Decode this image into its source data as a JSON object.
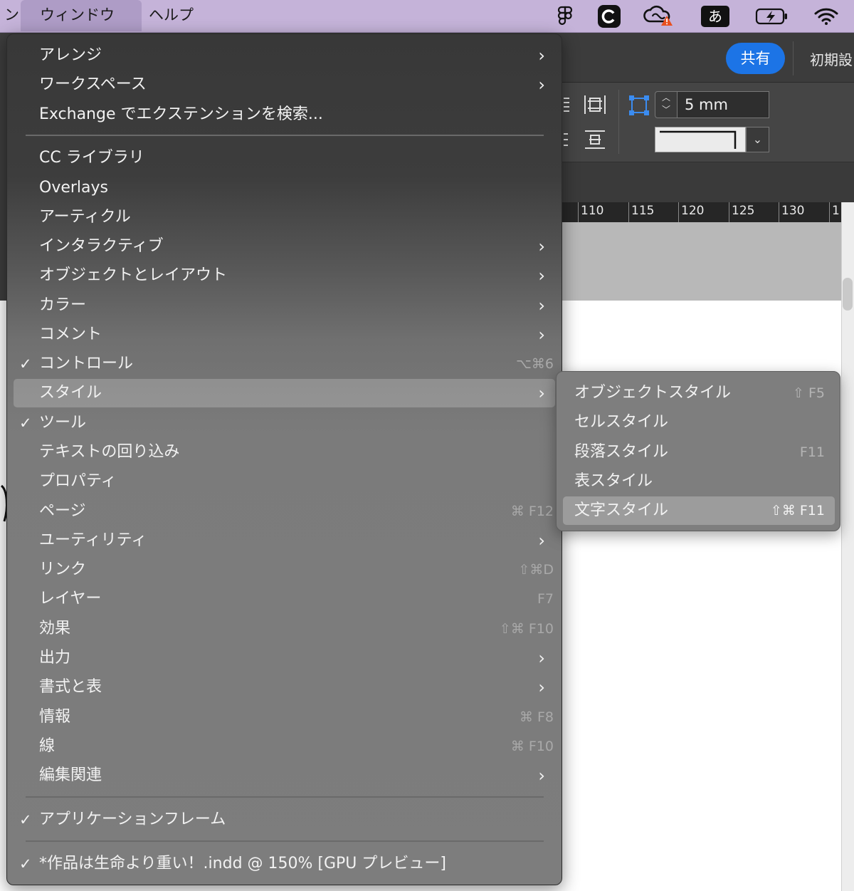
{
  "menubar": {
    "partial_item": "ン",
    "window_menu": "ウィンドウ",
    "help_menu": "ヘルプ",
    "ime_label": "あ",
    "tray_icons": [
      "figma-icon",
      "c-app-icon",
      "creative-cloud-icon",
      "ime-icon",
      "battery-charging-icon",
      "wifi-icon"
    ]
  },
  "app": {
    "share_button": "共有",
    "preset_label": "初期設",
    "stroke_value": "5 mm",
    "ruler_labels": [
      "110",
      "115",
      "120",
      "125",
      "130",
      "1"
    ]
  },
  "menu": {
    "items": [
      {
        "label": "アレンジ",
        "check": "",
        "shortcut": "",
        "submenu": true
      },
      {
        "label": "ワークスペース",
        "check": "",
        "shortcut": "",
        "submenu": true
      },
      {
        "label": "Exchange でエクステンションを検索...",
        "check": "",
        "shortcut": "",
        "submenu": false
      },
      {
        "label": "CC ライブラリ",
        "check": "",
        "shortcut": "",
        "submenu": false
      },
      {
        "label": "Overlays",
        "check": "",
        "shortcut": "",
        "submenu": false
      },
      {
        "label": "アーティクル",
        "check": "",
        "shortcut": "",
        "submenu": false
      },
      {
        "label": "インタラクティブ",
        "check": "",
        "shortcut": "",
        "submenu": true
      },
      {
        "label": "オブジェクトとレイアウト",
        "check": "",
        "shortcut": "",
        "submenu": true
      },
      {
        "label": "カラー",
        "check": "",
        "shortcut": "",
        "submenu": true
      },
      {
        "label": "コメント",
        "check": "",
        "shortcut": "",
        "submenu": true
      },
      {
        "label": "コントロール",
        "check": "✓",
        "shortcut": "⌥⌘6",
        "submenu": false
      },
      {
        "label": "スタイル",
        "check": "",
        "shortcut": "",
        "submenu": true
      },
      {
        "label": "ツール",
        "check": "✓",
        "shortcut": "",
        "submenu": false
      },
      {
        "label": "テキストの回り込み",
        "check": "",
        "shortcut": "",
        "submenu": false
      },
      {
        "label": "プロパティ",
        "check": "",
        "shortcut": "",
        "submenu": false
      },
      {
        "label": "ページ",
        "check": "",
        "shortcut": "⌘ F12",
        "submenu": false
      },
      {
        "label": "ユーティリティ",
        "check": "",
        "shortcut": "",
        "submenu": true
      },
      {
        "label": "リンク",
        "check": "",
        "shortcut": "⇧⌘D",
        "submenu": false
      },
      {
        "label": "レイヤー",
        "check": "",
        "shortcut": "F7",
        "submenu": false
      },
      {
        "label": "効果",
        "check": "",
        "shortcut": "⇧⌘ F10",
        "submenu": false
      },
      {
        "label": "出力",
        "check": "",
        "shortcut": "",
        "submenu": true
      },
      {
        "label": "書式と表",
        "check": "",
        "shortcut": "",
        "submenu": true
      },
      {
        "label": "情報",
        "check": "",
        "shortcut": "⌘ F8",
        "submenu": false
      },
      {
        "label": "線",
        "check": "",
        "shortcut": "⌘ F10",
        "submenu": false
      },
      {
        "label": "編集関連",
        "check": "",
        "shortcut": "",
        "submenu": true
      },
      {
        "label": "アプリケーションフレーム",
        "check": "✓",
        "shortcut": "",
        "submenu": false
      },
      {
        "label": "*作品は生命より重い！.indd @ 150% [GPU プレビュー]",
        "check": "✓",
        "shortcut": "",
        "submenu": false
      }
    ],
    "highlighted": "スタイル"
  },
  "submenu": {
    "items": [
      {
        "label": "オブジェクトスタイル",
        "shortcut": "⇧ F5"
      },
      {
        "label": "セルスタイル",
        "shortcut": ""
      },
      {
        "label": "段落スタイル",
        "shortcut": "F11"
      },
      {
        "label": "表スタイル",
        "shortcut": ""
      },
      {
        "label": "文字スタイル",
        "shortcut": "⇧⌘ F11"
      }
    ],
    "highlighted": "文字スタイル"
  }
}
